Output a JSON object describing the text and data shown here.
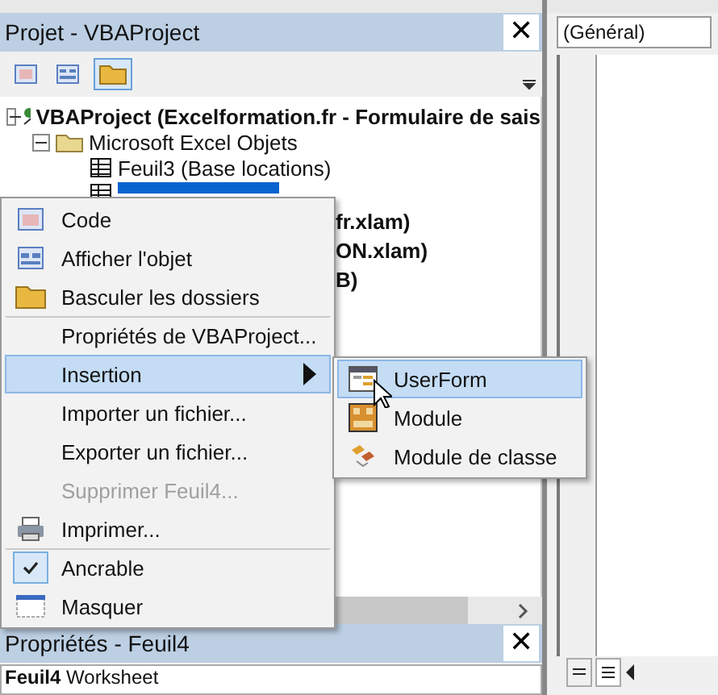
{
  "project_panel": {
    "title": "Projet - VBAProject",
    "close": "✕",
    "tree": [
      {
        "label": "VBAProject (Excelformation.fr - Formulaire de sais",
        "kind": "project",
        "expanded": true,
        "children": [
          {
            "label": "Microsoft Excel Objets",
            "kind": "folder",
            "expanded": true,
            "children": [
              {
                "label": "Feuil3 (Base locations)",
                "kind": "sheet",
                "selected": false
              },
              {
                "kind": "sheet",
                "selected": true
              }
            ]
          }
        ]
      }
    ],
    "hidden_rows": [
      "fr.xlam)",
      "ON.xlam)",
      "B)"
    ]
  },
  "context_menu": [
    {
      "label": "Code",
      "kind": "code",
      "separator_before": false,
      "disabled": false,
      "selected": false,
      "submenu": false
    },
    {
      "label": "Afficher l'objet",
      "kind": "object",
      "separator_before": false,
      "disabled": false,
      "selected": false,
      "submenu": false
    },
    {
      "label": "Basculer les dossiers",
      "kind": "folder",
      "separator_before": false,
      "disabled": false,
      "selected": false,
      "submenu": false
    },
    {
      "label": "Propriétés de VBAProject...",
      "kind": "plain",
      "separator_before": true,
      "disabled": false,
      "selected": false,
      "submenu": false
    },
    {
      "label": "Insertion",
      "kind": "plain",
      "separator_before": false,
      "disabled": false,
      "selected": true,
      "submenu": true
    },
    {
      "label": "Importer un fichier...",
      "kind": "plain",
      "separator_before": false,
      "disabled": false,
      "selected": false,
      "submenu": false
    },
    {
      "label": "Exporter un fichier...",
      "kind": "plain",
      "separator_before": false,
      "disabled": false,
      "selected": false,
      "submenu": false
    },
    {
      "label": "Supprimer Feuil4...",
      "kind": "plain",
      "separator_before": false,
      "disabled": true,
      "selected": false,
      "submenu": false
    },
    {
      "label": "Imprimer...",
      "kind": "printer",
      "separator_before": false,
      "disabled": false,
      "selected": false,
      "submenu": false
    },
    {
      "label": "Ancrable",
      "kind": "check",
      "separator_before": true,
      "disabled": false,
      "selected": false,
      "submenu": false
    },
    {
      "label": "Masquer",
      "kind": "window",
      "separator_before": false,
      "disabled": false,
      "selected": false,
      "submenu": false
    }
  ],
  "submenu": [
    {
      "label": "UserForm",
      "kind": "userform",
      "selected": true
    },
    {
      "label": "Module",
      "kind": "module",
      "selected": false
    },
    {
      "label": "Module de classe",
      "kind": "class",
      "selected": false
    }
  ],
  "properties_panel": {
    "title": "Propriétés - Feuil4",
    "close": "✕",
    "object_name": "Feuil4",
    "object_type": "Worksheet"
  },
  "code_window": {
    "object_combo": "(Général)"
  }
}
